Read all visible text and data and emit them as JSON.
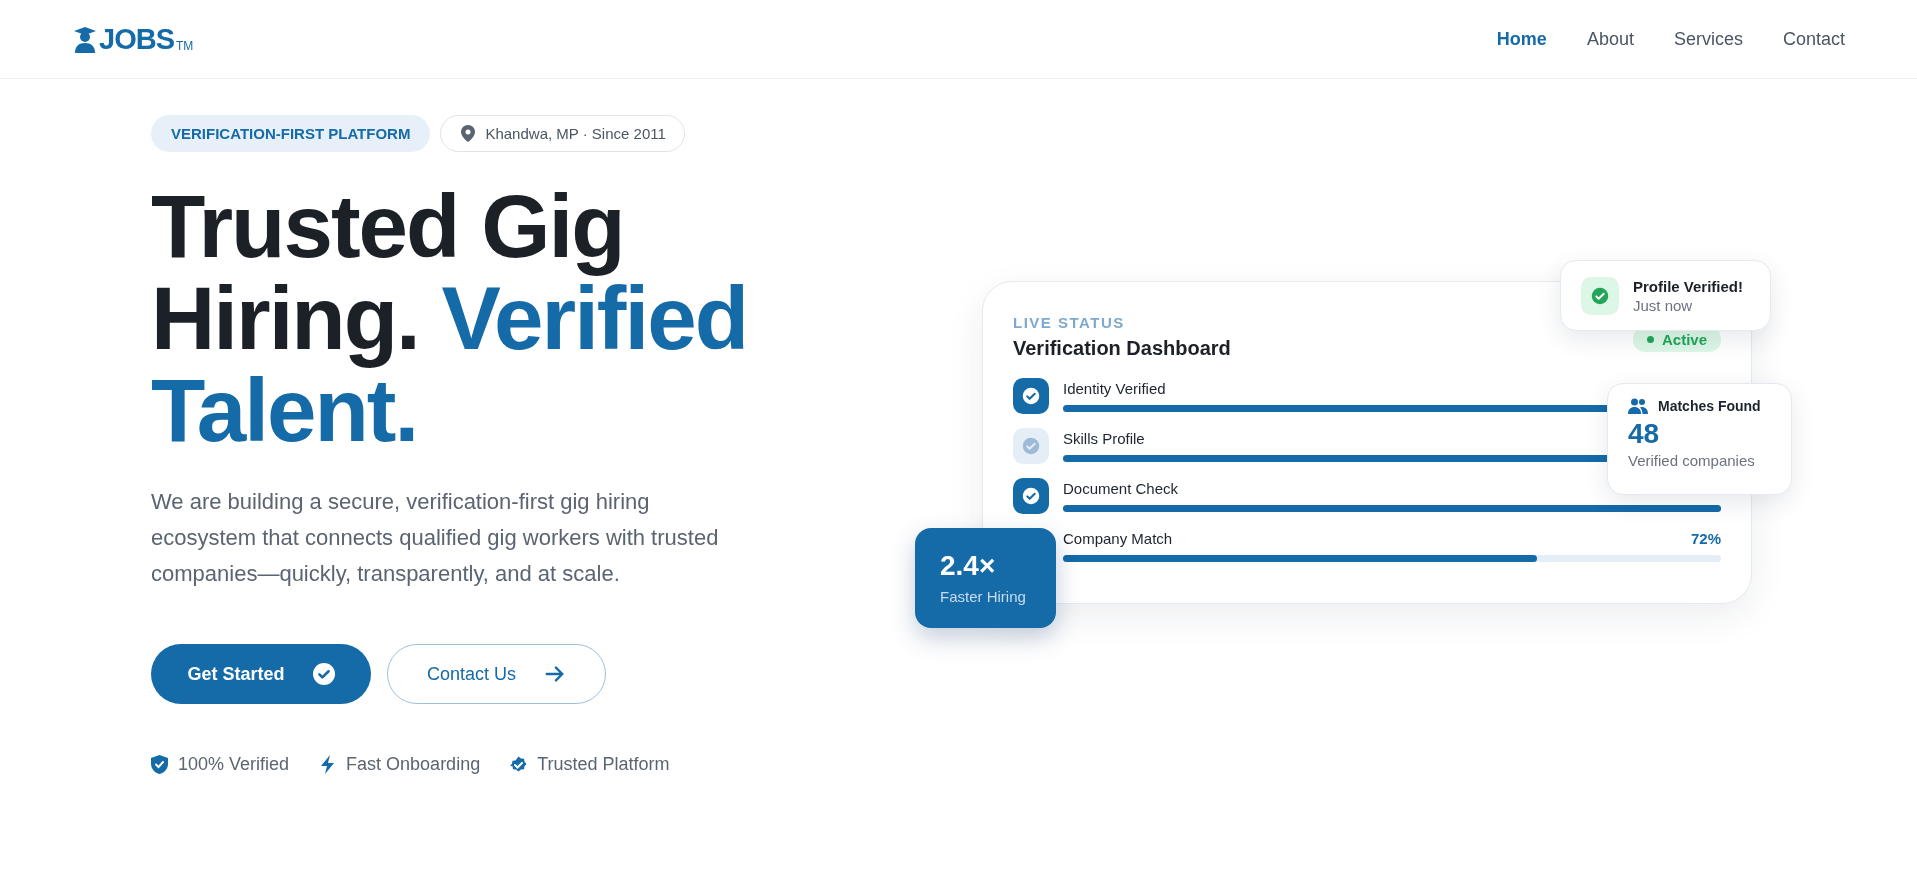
{
  "header": {
    "logo": {
      "text": "JOBS",
      "mark": "TM"
    },
    "nav": [
      {
        "label": "Home",
        "selected": true
      },
      {
        "label": "About",
        "selected": false
      },
      {
        "label": "Services",
        "selected": false
      },
      {
        "label": "Contact",
        "selected": false
      }
    ]
  },
  "hero": {
    "tag": "VERIFICATION-FIRST PLATFORM",
    "location": "Khandwa, MP · Since 2011",
    "headline": [
      {
        "text": "Trusted Gig Hiring.",
        "accent": false
      },
      {
        "text": "Verified Talent.",
        "accent": true
      }
    ],
    "description": "We are building a secure, verification-first gig hiring ecosystem that connects qualified gig workers with trusted companies—quickly, transparently, and at scale.",
    "buttons": [
      {
        "label": "Get Started",
        "kind": "primary"
      },
      {
        "label": "Contact Us",
        "kind": "outline"
      }
    ],
    "features": [
      {
        "label": "100% Verified",
        "kind": "shield"
      },
      {
        "label": "Fast Onboarding",
        "kind": "bolt"
      },
      {
        "label": "Trusted Platform",
        "kind": "badge"
      }
    ]
  },
  "dashboard": {
    "eyebrow": "LIVE STATUS",
    "title": "Verification Dashboard",
    "status": "Active",
    "rows": [
      {
        "label": "Identity Verified",
        "done": true,
        "level": 1.0
      },
      {
        "label": "Skills Profile",
        "done": false,
        "level": 1.0
      },
      {
        "label": "Document Check",
        "done": true,
        "level": 1.0
      },
      {
        "label": "Company Match",
        "level": 0.72,
        "percent": "72%"
      }
    ],
    "toast": {
      "title": "Profile Verified!",
      "time": "Just now"
    },
    "matches": {
      "title": "Matches Found",
      "count": "48",
      "caption": "Verified companies"
    },
    "speed": {
      "value": "2.4×",
      "caption": "Faster Hiring"
    }
  }
}
